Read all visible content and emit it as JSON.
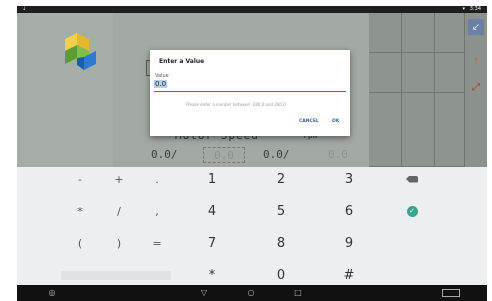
{
  "status_bar": {
    "time": "3:34"
  },
  "app": {
    "motor_label": "Motor Speed",
    "rpm_label": "rpm",
    "readouts": [
      "0.0/",
      "0.0",
      "0.0/",
      "0.0"
    ]
  },
  "dialog": {
    "title": "Enter a Value",
    "value_label": "Value",
    "value": "0.0",
    "hint": "Please enter a number between -280.0 and 280.0",
    "cancel_label": "CANCEL",
    "ok_label": "OK"
  },
  "keyboard": {
    "row1": [
      "-",
      "+",
      ".",
      "1",
      "2",
      "3"
    ],
    "row2": [
      "*",
      "/",
      ",",
      "4",
      "5",
      "6"
    ],
    "row3": [
      "(",
      ")",
      "=",
      "7",
      "8",
      "9"
    ],
    "row4": [
      "*",
      "0",
      "#"
    ],
    "delete_icon": "backspace-icon",
    "done_icon": "check-icon"
  },
  "nav_bar": {
    "icons": [
      "logo-icon",
      "back-icon",
      "home-icon",
      "recents-icon",
      "keyboard-icon"
    ]
  },
  "colors": {
    "accent": "#3a6fb4",
    "done": "#3aa38e",
    "nav": "#111111"
  }
}
